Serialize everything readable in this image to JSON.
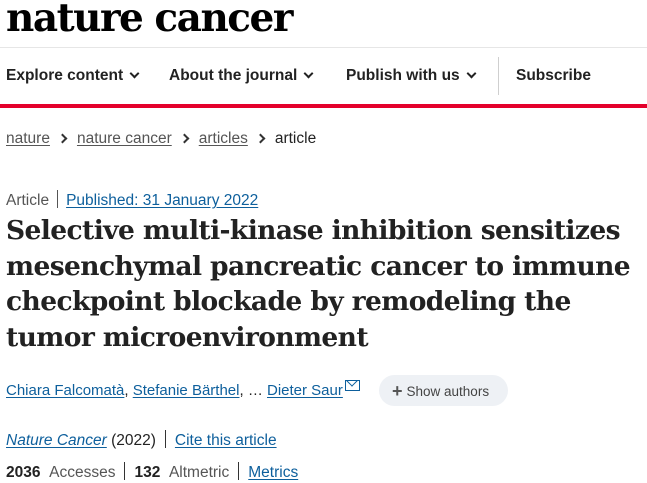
{
  "site": {
    "logo": "nature cancer"
  },
  "nav": {
    "explore": "Explore content",
    "about": "About the journal",
    "publish": "Publish with us",
    "subscribe": "Subscribe"
  },
  "breadcrumb": [
    "nature",
    "nature cancer",
    "articles",
    "article"
  ],
  "article": {
    "type": "Article",
    "published": "Published: 31 January 2022",
    "title": "Selective multi-kinase inhibition sensitizes mesenchymal pancreatic cancer to immune checkpoint blockade by remodeling the tumor microenvironment",
    "authors": [
      "Chiara Falcomatà",
      "Stefanie Bärthel",
      "Dieter Saur"
    ],
    "authors_separator": ",",
    "authors_ellipsis": ", …",
    "show_authors": "Show authors",
    "journal": "Nature Cancer",
    "year": "(2022)",
    "cite": "Cite this article"
  },
  "metrics": {
    "accesses_count": "2036",
    "accesses_label": "Accesses",
    "altmetric_count": "132",
    "altmetric_label": "Altmetric",
    "metrics_link": "Metrics"
  },
  "colors": {
    "accent_red": "#e4002b",
    "link_blue": "#0d5f9c"
  },
  "icons": [
    "chevron-down-icon",
    "chevron-right-icon",
    "mail-icon",
    "plus-icon"
  ]
}
